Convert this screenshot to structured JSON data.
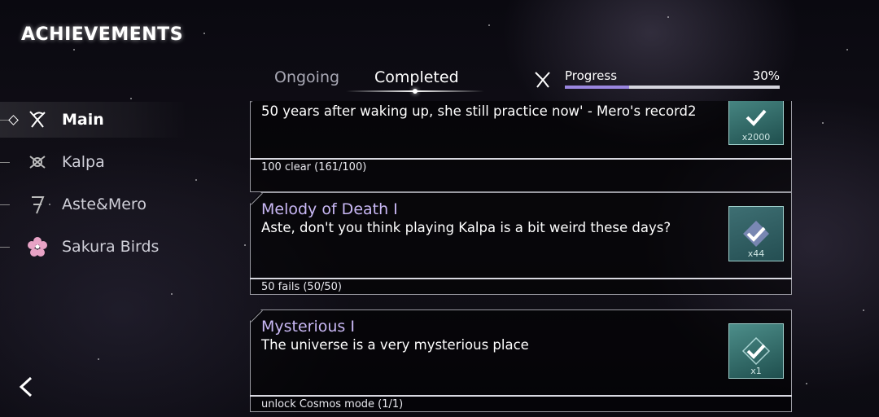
{
  "title": "ACHIEVEMENTS",
  "sidebar": {
    "items": [
      {
        "label": "Main",
        "icon": "butterfly-icon",
        "active": true
      },
      {
        "label": "Kalpa",
        "icon": "kalpa-icon",
        "active": false
      },
      {
        "label": "Aste&Mero",
        "icon": "seven-icon",
        "active": false
      },
      {
        "label": "Sakura Birds",
        "icon": "sakura-icon",
        "active": false
      }
    ]
  },
  "tabs": {
    "ongoing": "Ongoing",
    "completed": "Completed",
    "active": "Completed"
  },
  "progress": {
    "label": "Progress",
    "percent_text": "30%",
    "value": 0.3
  },
  "achievements": [
    {
      "name": "",
      "description": "50 years after waking up, she still practice now' - Mero's record2",
      "requirement": "100 clear (161/100)",
      "reward_count": "x2000"
    },
    {
      "name": "Melody of Death I",
      "description": "Aste, don't you think playing Kalpa is a bit weird these days?",
      "requirement": "50 fails (50/50)",
      "reward_count": "x44"
    },
    {
      "name": "Mysterious I",
      "description": "The universe is a very mysterious place",
      "requirement": "unlock Cosmos mode (1/1)",
      "reward_count": "x1"
    }
  ],
  "colors": {
    "accent": "#9a86e0",
    "name_text": "#c9b8f5",
    "reward_bg": "#3f7c79"
  }
}
